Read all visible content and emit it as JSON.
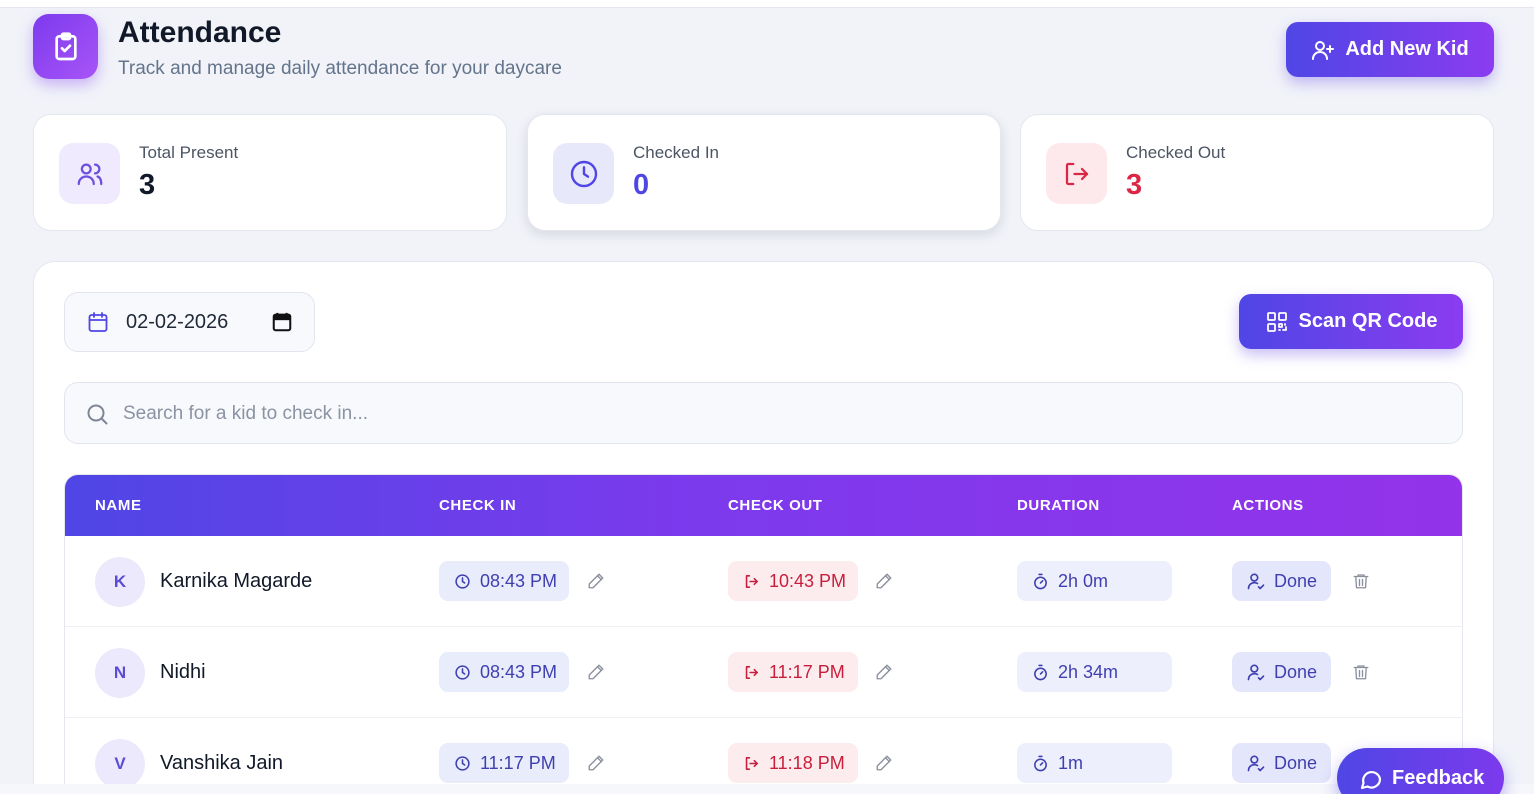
{
  "header": {
    "title": "Attendance",
    "subtitle": "Track and manage daily attendance for your daycare",
    "add_button_label": "Add New Kid",
    "icon": "clipboard-check-icon"
  },
  "stats": [
    {
      "label": "Total Present",
      "value": "3",
      "icon": "users-icon",
      "color": "#111827",
      "icon_bg": "#efeafd",
      "icon_color": "#6d4fe0"
    },
    {
      "label": "Checked In",
      "value": "0",
      "icon": "clock-icon",
      "color": "#4f46e5",
      "icon_bg": "#e8e8fb",
      "icon_color": "#4f46e5"
    },
    {
      "label": "Checked Out",
      "value": "3",
      "icon": "log-out-icon",
      "color": "#dc2645",
      "icon_bg": "#fde8ec",
      "icon_color": "#dc2645"
    }
  ],
  "toolbar": {
    "date_value": "02-02-2026",
    "scan_button_label": "Scan QR Code"
  },
  "search": {
    "placeholder": "Search for a kid to check in..."
  },
  "table": {
    "columns": [
      "NAME",
      "CHECK IN",
      "CHECK OUT",
      "DURATION",
      "ACTIONS"
    ],
    "rows": [
      {
        "initial": "K",
        "name": "Karnika Magarde",
        "check_in": "08:43 PM",
        "check_out": "10:43 PM",
        "duration": "2h 0m",
        "action": "Done"
      },
      {
        "initial": "N",
        "name": "Nidhi",
        "check_in": "08:43 PM",
        "check_out": "11:17 PM",
        "duration": "2h 34m",
        "action": "Done"
      },
      {
        "initial": "V",
        "name": "Vanshika Jain",
        "check_in": "11:17 PM",
        "check_out": "11:18 PM",
        "duration": "1m",
        "action": "Done"
      }
    ]
  },
  "feedback": {
    "label": "Feedback"
  },
  "colors": {
    "accent": "#4f46e5",
    "accent_end": "#9333ea",
    "danger": "#dc2645"
  }
}
